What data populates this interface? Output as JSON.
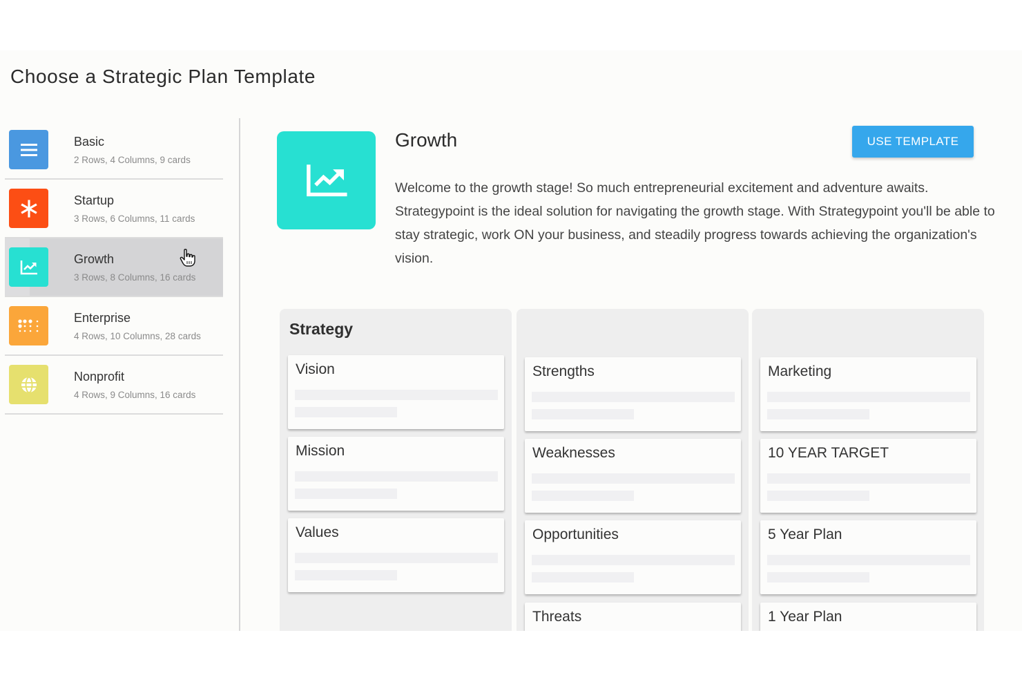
{
  "page": {
    "title": "Choose a Strategic Plan Template"
  },
  "templates": [
    {
      "name": "Basic",
      "meta": "2 Rows, 4 Columns, 9 cards",
      "icon": "list-icon",
      "color": "#4a98e0",
      "selected": false
    },
    {
      "name": "Startup",
      "meta": "3 Rows, 6 Columns, 11 cards",
      "icon": "asterisk-icon",
      "color": "#fc4e14",
      "selected": false
    },
    {
      "name": "Growth",
      "meta": "3 Rows, 8 Columns, 16 cards",
      "icon": "trending-up-icon",
      "color": "#27e0d2",
      "selected": true
    },
    {
      "name": "Enterprise",
      "meta": "4 Rows, 10 Columns, 28 cards",
      "icon": "grid-dots-icon",
      "color": "#fba63a",
      "selected": false
    },
    {
      "name": "Nonprofit",
      "meta": "4 Rows, 9 Columns, 16 cards",
      "icon": "globe-icon",
      "color": "#e6e06e",
      "selected": false
    }
  ],
  "detail": {
    "title": "Growth",
    "icon": "trending-up-icon",
    "icon_color": "#27e0d2",
    "use_button_label": "USE TEMPLATE",
    "button_color": "#35a7ec",
    "description": "Welcome to the growth stage! So much entrepreneurial excitement and adventure awaits. Strategypoint is the ideal solution for navigating the growth stage. With Strategypoint you'll be able to stay strategic, work ON your business, and steadily progress towards achieving the organization's vision."
  },
  "board": {
    "columns": [
      {
        "title": "Strategy",
        "cards": [
          "Vision",
          "Mission",
          "Values"
        ]
      },
      {
        "title": "",
        "cards": [
          "Strengths",
          "Weaknesses",
          "Opportunities",
          "Threats"
        ]
      },
      {
        "title": "",
        "cards": [
          "Marketing",
          "10 YEAR TARGET",
          "5 Year Plan",
          "1 Year Plan"
        ]
      }
    ]
  }
}
